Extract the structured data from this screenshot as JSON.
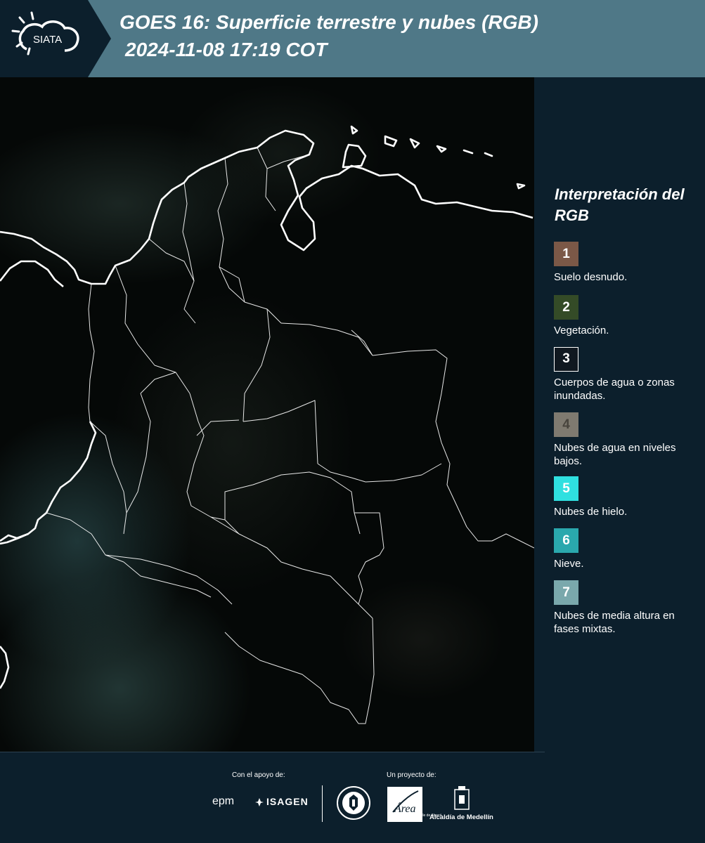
{
  "header": {
    "logo_text": "SIATA",
    "title_line1": "GOES 16: Superficie terrestre y nubes (RGB)",
    "title_line2": "2024-11-08 17:19 COT"
  },
  "legend": {
    "title": "Interpretación del RGB",
    "items": [
      {
        "number": "1",
        "label": "Suelo desnudo.",
        "color": "#7b5847"
      },
      {
        "number": "2",
        "label": "Vegetación.",
        "color": "#344b27"
      },
      {
        "number": "3",
        "label": "Cuerpos de agua o zonas inundadas.",
        "color": "#101820"
      },
      {
        "number": "4",
        "label": "Nubes de agua en niveles bajos.",
        "color": "#7f7a70"
      },
      {
        "number": "5",
        "label": "Nubes de hielo.",
        "color": "#2fe0e0"
      },
      {
        "number": "6",
        "label": "Nieve.",
        "color": "#2aa8ad"
      },
      {
        "number": "7",
        "label": "Nubes de media altura en fases mixtas.",
        "color": "#7aa8ac"
      }
    ]
  },
  "footer": {
    "support_caption": "Con el apoyo de:",
    "project_caption": "Un proyecto de:",
    "epm_logo": "epm",
    "isagen_logo": "ISAGEN",
    "amva_logo": "Área",
    "amva_caption": "METROPOLITANA Valle de Aburrá",
    "alcaldia_logo": "Alcaldía de Medellín"
  }
}
